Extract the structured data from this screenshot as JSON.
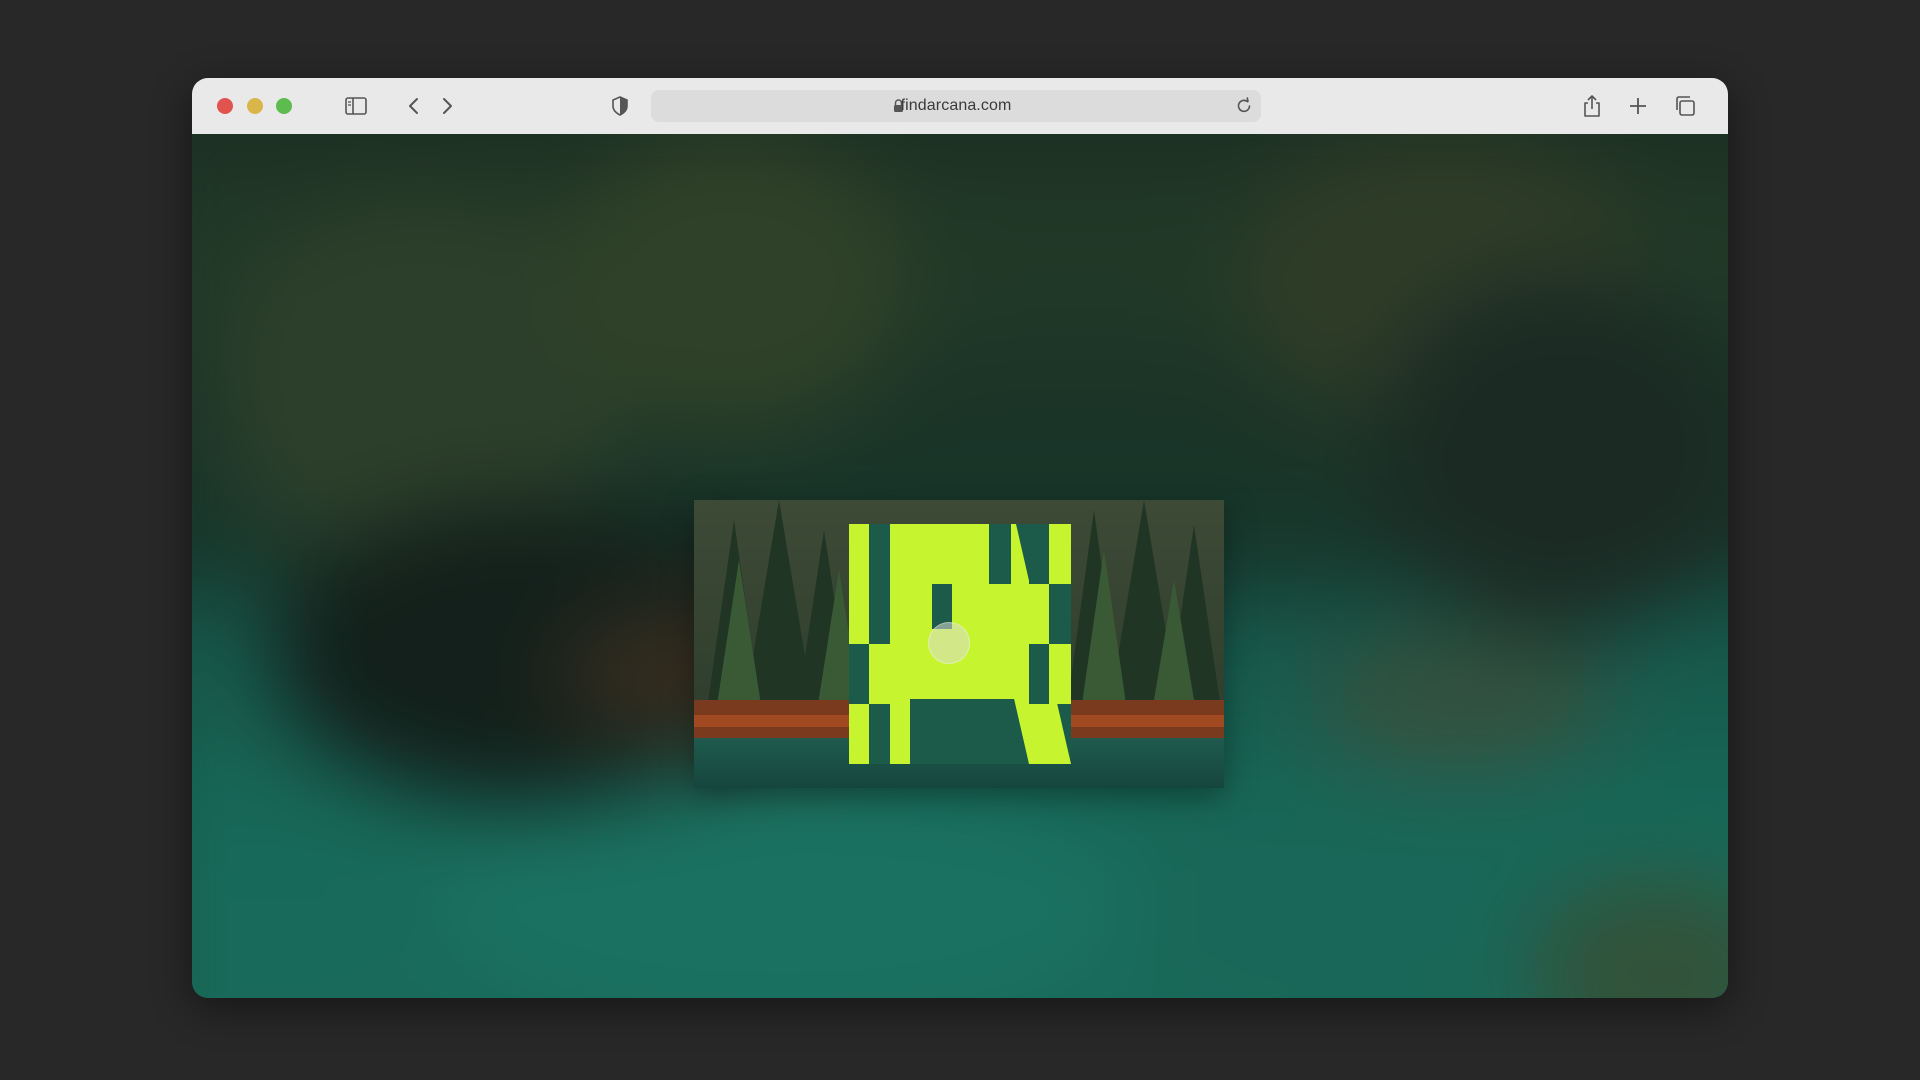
{
  "browser": {
    "url": "findarcana.com",
    "icons": {
      "close": "close-window-button",
      "minimize": "minimize-window-button",
      "zoom": "zoom-window-button",
      "sidebar": "sidebar-icon",
      "back": "chevron-left-icon",
      "forward": "chevron-right-icon",
      "privacy": "shield-icon",
      "lock": "lock-icon",
      "reload": "reload-icon",
      "share": "share-icon",
      "new_tab": "plus-icon",
      "tabs": "tab-overview-icon"
    },
    "colors": {
      "close": "#e0534e",
      "minimize": "#d9b54a",
      "zoom": "#5dbb4f",
      "toolbar": "#e9e9e9"
    }
  },
  "page": {
    "logo_letter_color": "#c6f52f",
    "logo": "arcana-logo",
    "background": "blurred-forest-lake"
  }
}
